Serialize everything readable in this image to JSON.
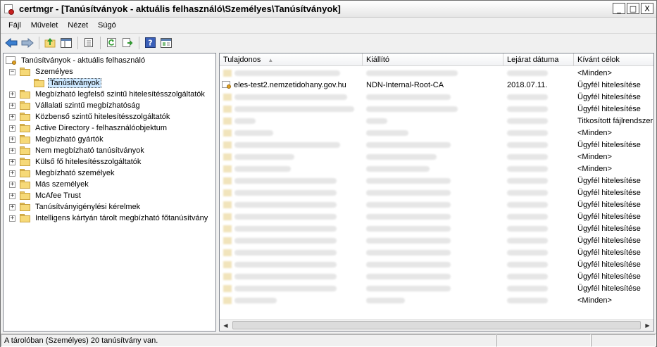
{
  "window": {
    "title": "certmgr - [Tanúsítványok - aktuális felhasználó\\Személyes\\Tanúsítványok]",
    "controls": {
      "minimize": "_",
      "maximize": "□",
      "close": "X"
    }
  },
  "menu": [
    "Fájl",
    "Művelet",
    "Nézet",
    "Súgó"
  ],
  "toolbar": [
    "back-icon",
    "forward-icon",
    "up-folder-icon",
    "show-tree-icon",
    "properties-icon",
    "refresh-icon",
    "export-icon",
    "help-icon",
    "console-icon"
  ],
  "tree": {
    "root": "Tanúsítványok - aktuális felhasználó",
    "personal": {
      "label": "Személyes",
      "expander": "−"
    },
    "selected": "Tanúsítványok",
    "items": [
      {
        "label": "Megbízható legfelső szintű hitelesítésszolgáltatók",
        "expander": "+"
      },
      {
        "label": "Vállalati szintű megbízhatóság",
        "expander": "+"
      },
      {
        "label": "Közbenső szintű hitelesítésszolgáltatók",
        "expander": "+"
      },
      {
        "label": "Active Directory - felhasználóobjektum",
        "expander": "+"
      },
      {
        "label": "Megbízható gyártók",
        "expander": "+"
      },
      {
        "label": "Nem megbízható tanúsítványok",
        "expander": "+"
      },
      {
        "label": "Külső fő hitelesítésszolgáltatók",
        "expander": "+"
      },
      {
        "label": "Megbízható személyek",
        "expander": "+"
      },
      {
        "label": "Más személyek",
        "expander": "+"
      },
      {
        "label": "McAfee Trust",
        "expander": "+"
      },
      {
        "label": "Tanúsítványigénylési kérelmek",
        "expander": "+"
      },
      {
        "label": "Intelligens kártyán tárolt megbízható főtanúsítvány",
        "expander": "+"
      }
    ]
  },
  "table": {
    "columns": [
      "Tulajdonos",
      "Kiállító",
      "Lejárat dátuma",
      "Kívánt célok"
    ],
    "sort_indicator": "▲",
    "rows": [
      {
        "blurred": true,
        "purpose": "<Minden>"
      },
      {
        "blurred": false,
        "owner": "eles-test2.nemzetidohany.gov.hu",
        "issuer": "NDN-Internal-Root-CA",
        "expires": "2018.07.11.",
        "purpose": "Ügyfél hitelesítése"
      },
      {
        "blurred": true,
        "purpose": "Ügyfél hitelesítése"
      },
      {
        "blurred": true,
        "purpose": "Ügyfél hitelesítése"
      },
      {
        "blurred": true,
        "purpose": "Titkosított fájlrendszer"
      },
      {
        "blurred": true,
        "purpose": "<Minden>"
      },
      {
        "blurred": true,
        "purpose": "Ügyfél hitelesítése"
      },
      {
        "blurred": true,
        "purpose": "<Minden>"
      },
      {
        "blurred": true,
        "purpose": "<Minden>"
      },
      {
        "blurred": true,
        "purpose": "Ügyfél hitelesítése"
      },
      {
        "blurred": true,
        "purpose": "Ügyfél hitelesítése"
      },
      {
        "blurred": true,
        "purpose": "Ügyfél hitelesítése"
      },
      {
        "blurred": true,
        "purpose": "Ügyfél hitelesítése"
      },
      {
        "blurred": true,
        "purpose": "Ügyfél hitelesítése"
      },
      {
        "blurred": true,
        "purpose": "Ügyfél hitelesítése"
      },
      {
        "blurred": true,
        "purpose": "Ügyfél hitelesítése"
      },
      {
        "blurred": true,
        "purpose": "Ügyfél hitelesítése"
      },
      {
        "blurred": true,
        "purpose": "Ügyfél hitelesítése"
      },
      {
        "blurred": true,
        "purpose": "Ügyfél hitelesítése"
      },
      {
        "blurred": true,
        "purpose": "<Minden>"
      }
    ]
  },
  "scrollbar": {
    "left_arrow": "◀",
    "right_arrow": "▶"
  },
  "status": {
    "text": "A tárolóban (Személyes) 20 tanúsítvány van."
  }
}
